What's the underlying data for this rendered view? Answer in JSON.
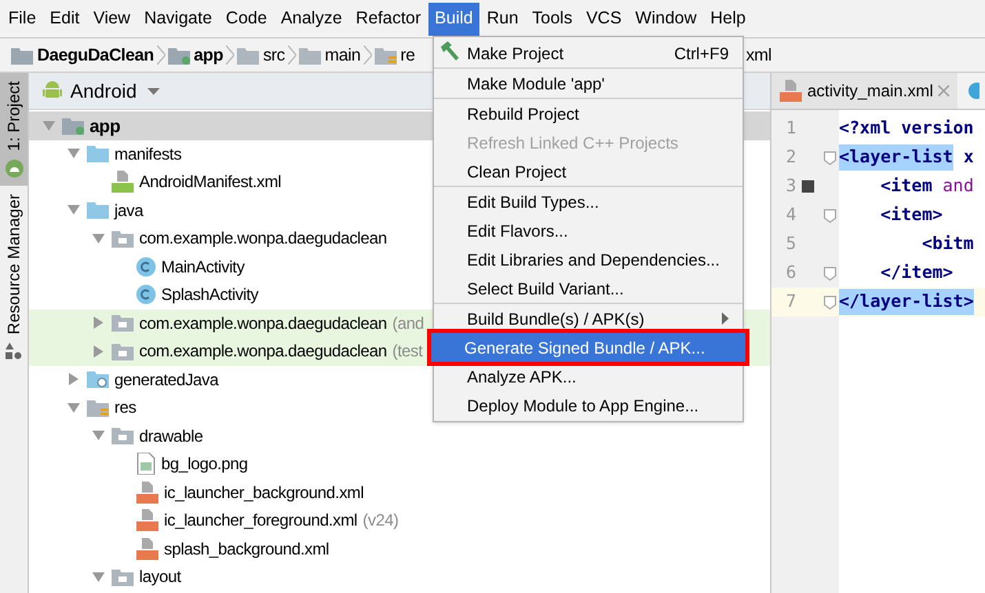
{
  "menu_bar": [
    {
      "label": "File",
      "selected": false
    },
    {
      "label": "Edit",
      "selected": false
    },
    {
      "label": "View",
      "selected": false
    },
    {
      "label": "Navigate",
      "selected": false
    },
    {
      "label": "Code",
      "selected": false
    },
    {
      "label": "Analyze",
      "selected": false
    },
    {
      "label": "Refactor",
      "selected": false
    },
    {
      "label": "Build",
      "selected": true
    },
    {
      "label": "Run",
      "selected": false
    },
    {
      "label": "Tools",
      "selected": false
    },
    {
      "label": "VCS",
      "selected": false
    },
    {
      "label": "Window",
      "selected": false
    },
    {
      "label": "Help",
      "selected": false
    }
  ],
  "breadcrumb": {
    "items": [
      {
        "label": "DaeguDaClean",
        "kind": "project"
      },
      {
        "label": "app",
        "kind": "module"
      },
      {
        "label": "src",
        "kind": "folder"
      },
      {
        "label": "main",
        "kind": "folder"
      },
      {
        "label": "re",
        "kind": "res"
      }
    ],
    "tail": "xml"
  },
  "tool_strip": [
    {
      "label": "1: Project",
      "selected": true
    },
    {
      "label": "Resource Manager",
      "selected": false
    }
  ],
  "project_panel": {
    "view": "Android",
    "tree": [
      {
        "label": "app",
        "kind": "module",
        "expanded": true,
        "selected": true,
        "highlighted": false,
        "children": [
          {
            "label": "manifests",
            "kind": "folder",
            "expanded": true,
            "selected": false,
            "highlighted": false,
            "children": [
              {
                "label": "AndroidManifest.xml",
                "kind": "manifest",
                "selected": false,
                "highlighted": false
              }
            ]
          },
          {
            "label": "java",
            "kind": "folder",
            "expanded": true,
            "selected": false,
            "highlighted": false,
            "children": [
              {
                "label": "com.example.wonpa.daegudaclean",
                "kind": "package",
                "expanded": true,
                "selected": false,
                "highlighted": false,
                "children": [
                  {
                    "label": "MainActivity",
                    "kind": "class",
                    "selected": false,
                    "highlighted": false
                  },
                  {
                    "label": "SplashActivity",
                    "kind": "class",
                    "selected": false,
                    "highlighted": false
                  }
                ]
              },
              {
                "label": "com.example.wonpa.daegudaclean",
                "suffix": "(and",
                "kind": "package",
                "expanded": false,
                "selected": false,
                "highlighted": true
              },
              {
                "label": "com.example.wonpa.daegudaclean",
                "suffix": "(test",
                "kind": "package",
                "expanded": false,
                "selected": false,
                "highlighted": true
              }
            ]
          },
          {
            "label": "generatedJava",
            "kind": "generated",
            "expanded": false,
            "selected": false,
            "highlighted": false
          },
          {
            "label": "res",
            "kind": "res",
            "expanded": true,
            "selected": false,
            "highlighted": false,
            "children": [
              {
                "label": "drawable",
                "kind": "package",
                "expanded": true,
                "selected": false,
                "highlighted": false,
                "children": [
                  {
                    "label": "bg_logo.png",
                    "kind": "image",
                    "selected": false,
                    "highlighted": false
                  },
                  {
                    "label": "ic_launcher_background.xml",
                    "kind": "xml",
                    "selected": false,
                    "highlighted": false
                  },
                  {
                    "label": "ic_launcher_foreground.xml",
                    "suffix": "(v24)",
                    "kind": "xml",
                    "selected": false,
                    "highlighted": false
                  },
                  {
                    "label": "splash_background.xml",
                    "kind": "xml",
                    "selected": false,
                    "highlighted": false
                  }
                ]
              },
              {
                "label": "layout",
                "kind": "package",
                "expanded": true,
                "selected": false,
                "highlighted": false
              }
            ]
          }
        ]
      }
    ]
  },
  "build_menu": [
    [
      {
        "label": "Make Project",
        "shortcut": "Ctrl+F9",
        "disabled": false,
        "selected": false
      }
    ],
    [
      {
        "label": "Make Module 'app'",
        "disabled": false,
        "selected": false
      }
    ],
    [
      {
        "label": "Rebuild Project",
        "disabled": false,
        "selected": false
      },
      {
        "label": "Refresh Linked C++ Projects",
        "disabled": true,
        "selected": false
      },
      {
        "label": "Clean Project",
        "disabled": false,
        "selected": false
      }
    ],
    [
      {
        "label": "Edit Build Types...",
        "disabled": false,
        "selected": false
      },
      {
        "label": "Edit Flavors...",
        "disabled": false,
        "selected": false
      },
      {
        "label": "Edit Libraries and Dependencies...",
        "disabled": false,
        "selected": false
      },
      {
        "label": "Select Build Variant...",
        "disabled": false,
        "selected": false
      }
    ],
    [
      {
        "label": "Build Bundle(s) / APK(s)",
        "submenu": true,
        "disabled": false,
        "selected": false
      },
      {
        "label": "Generate Signed Bundle / APK...",
        "disabled": false,
        "selected": true,
        "annotated": true
      },
      {
        "label": "Analyze APK...",
        "disabled": false,
        "selected": false
      },
      {
        "label": "Deploy Module to App Engine...",
        "disabled": false,
        "selected": false
      }
    ]
  ],
  "editor": {
    "tabs": [
      {
        "label": "activity_main.xml",
        "selected": true,
        "closable": true
      }
    ],
    "lines": [
      {
        "number": "1",
        "current": false,
        "tokens": [
          {
            "text": "<?xml version",
            "kind": "tag",
            "matched": false
          }
        ]
      },
      {
        "number": "2",
        "current": false,
        "fold": true,
        "tokens": [
          {
            "text": "<layer-list",
            "kind": "tag",
            "matched": true
          },
          {
            "text": " x",
            "kind": "tag",
            "matched": false
          }
        ]
      },
      {
        "number": "3",
        "current": false,
        "marker": true,
        "tokens": [
          {
            "text": "    <item ",
            "kind": "tag",
            "matched": false
          },
          {
            "text": "and",
            "kind": "attr",
            "matched": false
          }
        ]
      },
      {
        "number": "4",
        "current": false,
        "fold": true,
        "tokens": [
          {
            "text": "    <item>",
            "kind": "tag",
            "matched": false
          }
        ]
      },
      {
        "number": "5",
        "current": false,
        "tokens": [
          {
            "text": "        <bitm",
            "kind": "tag",
            "matched": false
          }
        ]
      },
      {
        "number": "6",
        "current": false,
        "fold": true,
        "tokens": [
          {
            "text": "    </item>",
            "kind": "tag",
            "matched": false
          }
        ]
      },
      {
        "number": "7",
        "current": true,
        "fold": true,
        "tokens": [
          {
            "text": "</layer-list",
            "kind": "tag",
            "matched": true
          },
          {
            "text": ">",
            "kind": "tag",
            "matched": true
          }
        ]
      }
    ]
  }
}
